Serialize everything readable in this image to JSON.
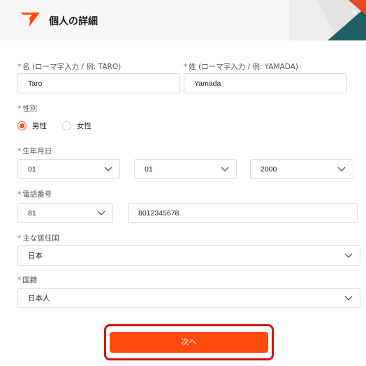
{
  "header": {
    "title": "個人の詳細",
    "close_glyph": "×"
  },
  "first_name": {
    "label": "名 (ローマ字入力 / 例: TARO)",
    "value": "Taro"
  },
  "last_name": {
    "label": "姓 (ローマ字入力 / 例: YAMADA)",
    "value": "Yamada"
  },
  "gender": {
    "label": "性別",
    "options": [
      {
        "label": "男性",
        "selected": true
      },
      {
        "label": "女性",
        "selected": false
      }
    ]
  },
  "birthdate": {
    "label": "生年月日",
    "month": "01",
    "day": "01",
    "year": "2000"
  },
  "phone": {
    "label": "電話番号",
    "country_code": "81",
    "number": "8012345678"
  },
  "residence": {
    "label": "主な居住国",
    "value": "日本"
  },
  "nationality": {
    "label": "国籍",
    "value": "日本人"
  },
  "required_mark": "*",
  "next_button": {
    "label": "次へ"
  },
  "colors": {
    "accent": "#ff4a0d",
    "highlight": "#d90f0f",
    "deco_teal": "#1f5f66"
  },
  "icons": {
    "logo": "brand-arrow-logo",
    "close": "close-icon",
    "dropdown": "chevron-down-icon"
  }
}
